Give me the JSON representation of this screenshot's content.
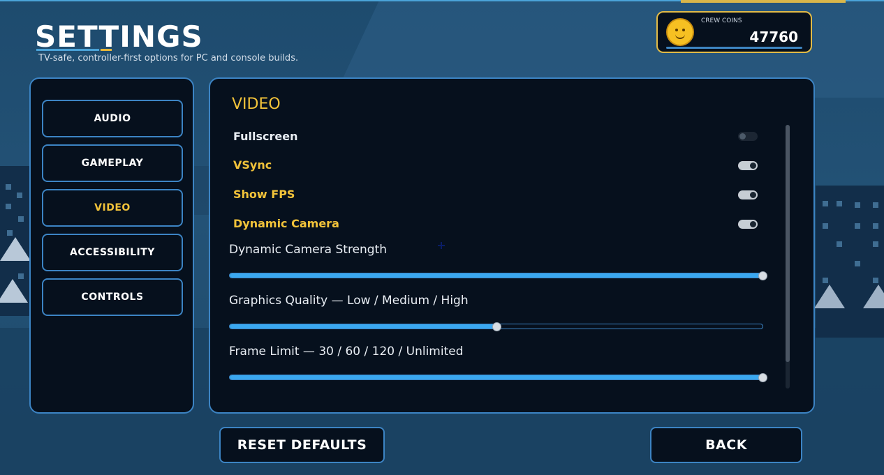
{
  "header": {
    "title": "SETTINGS",
    "subtitle": "TV-safe, controller-first options for PC and console builds."
  },
  "coins": {
    "label": "CREW COINS",
    "value": "47760",
    "icon": "smiley-coin-icon"
  },
  "tabs": [
    {
      "label": "AUDIO",
      "active": false
    },
    {
      "label": "GAMEPLAY",
      "active": false
    },
    {
      "label": "VIDEO",
      "active": true
    },
    {
      "label": "ACCESSIBILITY",
      "active": false
    },
    {
      "label": "CONTROLS",
      "active": false
    }
  ],
  "video": {
    "section_title": "VIDEO",
    "toggles": [
      {
        "label": "Fullscreen",
        "on": false
      },
      {
        "label": "VSync",
        "on": true
      },
      {
        "label": "Show FPS",
        "on": true
      },
      {
        "label": "Dynamic Camera",
        "on": true
      }
    ],
    "sliders": [
      {
        "label": "Dynamic Camera Strength",
        "value": 1.0
      },
      {
        "label": "Graphics Quality — Low / Medium / High",
        "value": 0.5
      },
      {
        "label": "Frame Limit — 30 / 60 / 120 / Unlimited",
        "value": 1.0
      }
    ]
  },
  "buttons": {
    "reset": "RESET DEFAULTS",
    "back": "BACK"
  },
  "colors": {
    "accent_blue": "#3c84c4",
    "slider_blue": "#3aa8f0",
    "gold": "#f2c33a",
    "panel_bg": "#06101d"
  }
}
